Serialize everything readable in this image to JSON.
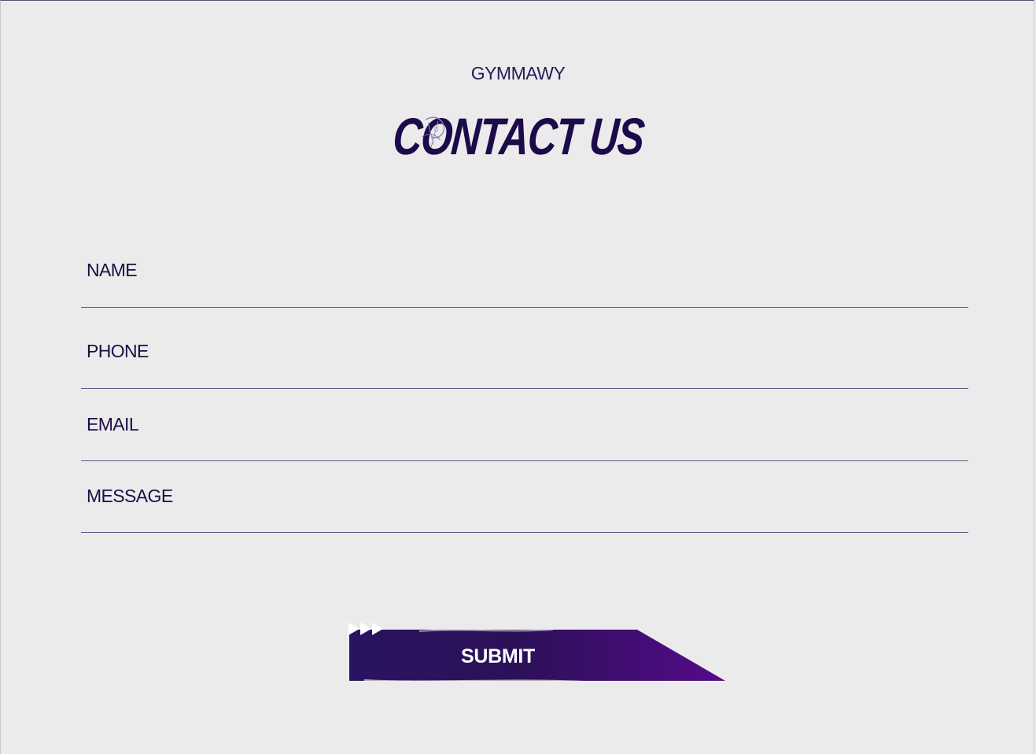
{
  "header": {
    "brand": "GYMMAWY",
    "title": "CONTACT US"
  },
  "form": {
    "fields": [
      {
        "name": "name",
        "placeholder": "NAME"
      },
      {
        "name": "phone",
        "placeholder": "PHONE"
      },
      {
        "name": "email",
        "placeholder": "EMAIL"
      },
      {
        "name": "message",
        "placeholder": "MESSAGE"
      }
    ],
    "submit_label": "SUBMIT"
  },
  "colors": {
    "background": "#ebebec",
    "text": "#1d0d45",
    "button_start": "#2a1360",
    "button_end": "#560a8a",
    "divider": "#5a5680"
  },
  "icons": {
    "submit_arrows": "triple-play-arrow-icon"
  }
}
